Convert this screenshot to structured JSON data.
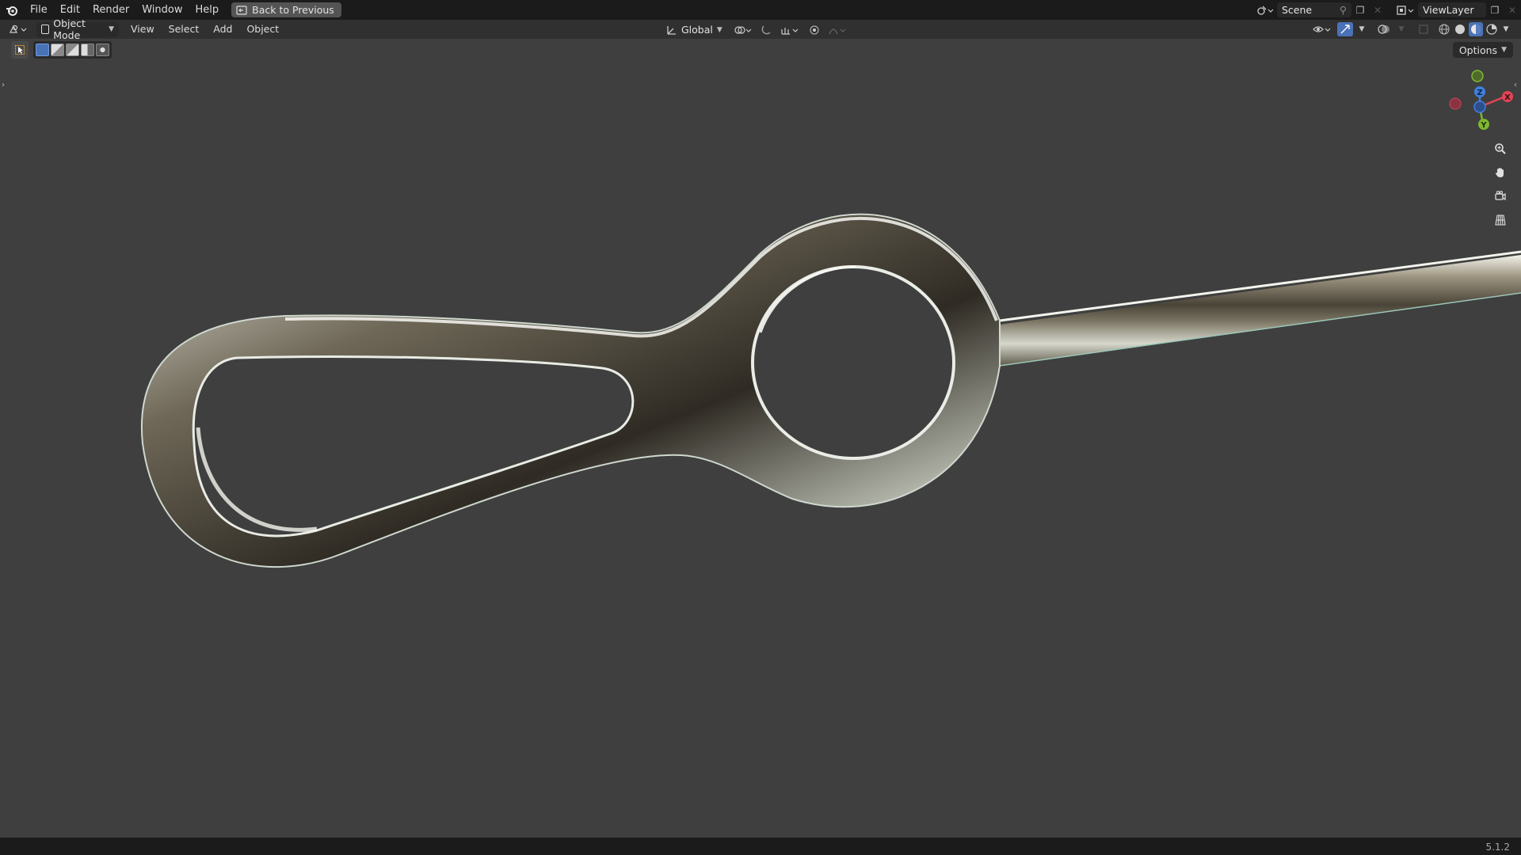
{
  "topbar": {
    "menu": [
      "File",
      "Edit",
      "Render",
      "Window",
      "Help"
    ],
    "back_label": "Back to Previous",
    "scene_name": "Scene",
    "view_layer_name": "ViewLayer"
  },
  "viewport_header": {
    "mode_label": "Object Mode",
    "menu": [
      "View",
      "Select",
      "Add",
      "Object"
    ],
    "transform_orientation": "Global"
  },
  "options_label": "Options",
  "gizmo": {
    "x_label": "X",
    "y_label": "Y",
    "z_label": "Z",
    "colors": {
      "x": "#e24454",
      "y": "#7fb72f",
      "z": "#3f7fe0"
    }
  },
  "status": {
    "version": "5.1.2"
  },
  "icons": [
    "blender-logo-icon",
    "back-icon",
    "scene-icon",
    "pin-icon",
    "new-scene-icon",
    "view-layer-icon",
    "editor-type-icon",
    "orientation-icon",
    "pivot-icon",
    "snap-icon",
    "proportional-icon",
    "visibility-icon",
    "gizmo-icon",
    "overlay-icon",
    "xray-icon",
    "wireframe-icon",
    "solid-icon",
    "material-icon",
    "rendered-icon",
    "zoom-icon",
    "pan-icon",
    "camera-icon",
    "ortho-grid-icon"
  ]
}
